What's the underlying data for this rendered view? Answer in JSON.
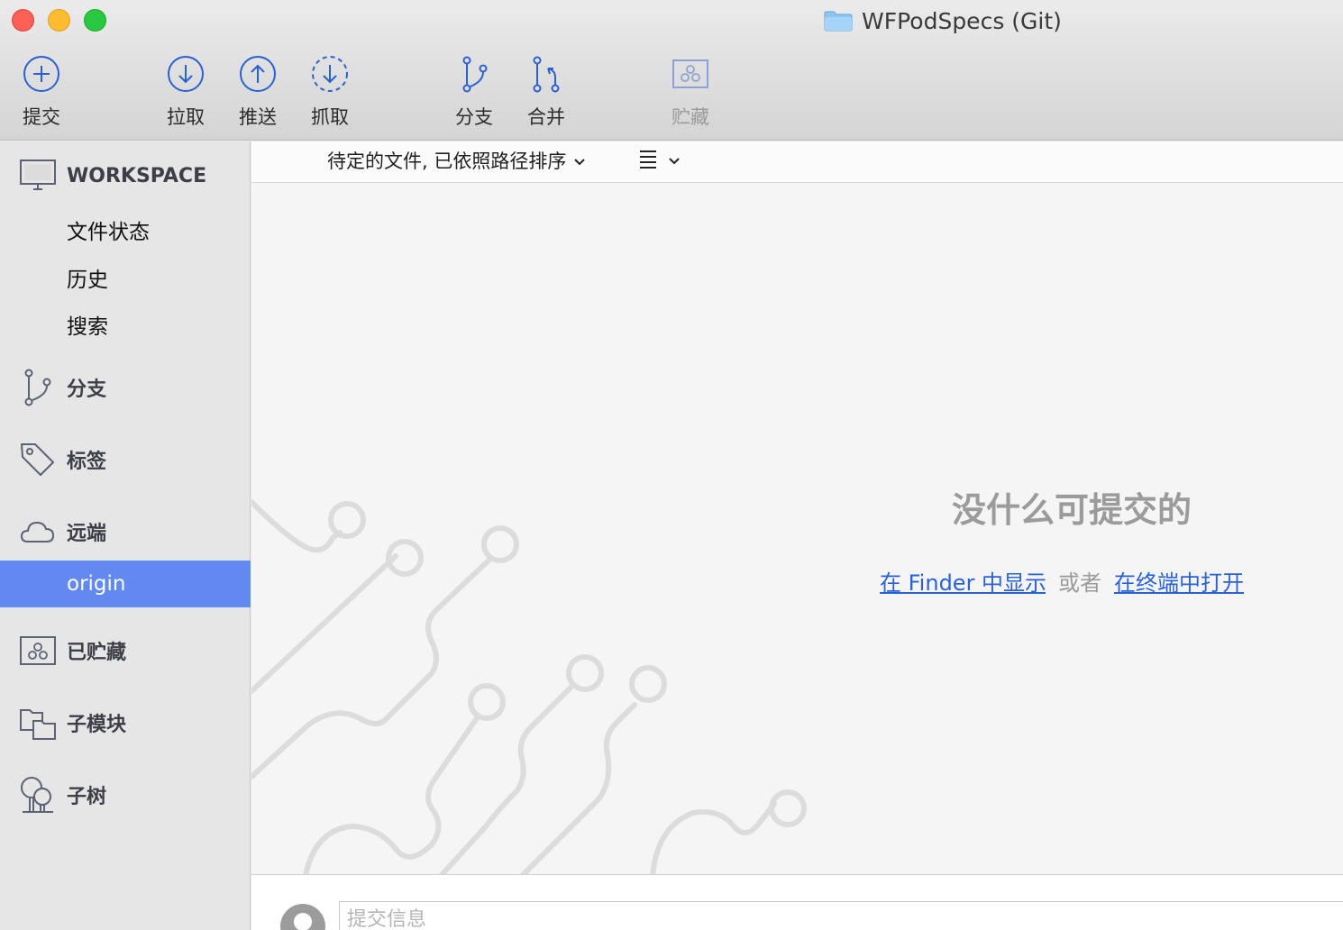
{
  "window": {
    "title": "WFPodSpecs (Git)"
  },
  "toolbar": {
    "commit": "提交",
    "pull": "拉取",
    "push": "推送",
    "fetch": "抓取",
    "branch": "分支",
    "merge": "合并",
    "stash": "贮藏"
  },
  "sidebar": {
    "workspace": "WORKSPACE",
    "file_status": "文件状态",
    "history": "历史",
    "search": "搜索",
    "branches": "分支",
    "tags": "标签",
    "remotes": "远端",
    "origin": "origin",
    "stashes": "已贮藏",
    "submodules": "子模块",
    "subtrees": "子树"
  },
  "main": {
    "sort_label": "待定的文件, 已依照路径排序",
    "empty_message": "没什么可提交的",
    "show_in_finder": "在 Finder 中显示",
    "or": "或者",
    "open_in_terminal": "在终端中打开",
    "commit_placeholder": "提交信息"
  },
  "colors": {
    "accent": "#6289f0",
    "icon_blue": "#2c5fcf",
    "link": "#2a62d6"
  }
}
